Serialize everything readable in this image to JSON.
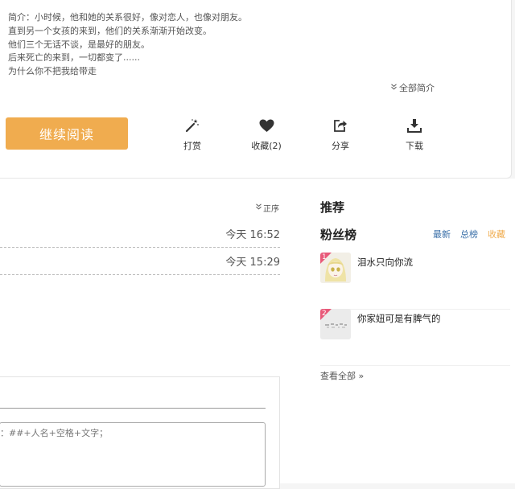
{
  "intro": {
    "lines": [
      "简介：小时候，他和她的关系很好，像对恋人，也像对朋友。",
      "直到另一个女孩的来到，他们的关系渐渐开始改变。",
      "他们三个无话不谈，是最好的朋友。",
      "后来死亡的来到，一切都变了......",
      "为什么你不把我给带走"
    ],
    "toggle_icon": "double-chevron-down-icon",
    "toggle_label": "全部简介"
  },
  "actions": {
    "read_label": "继续阅读",
    "reward_label": "打赏",
    "favorite_label": "收藏(2)",
    "share_label": "分享",
    "download_label": "下载"
  },
  "chapters": {
    "sort_label": "正序",
    "rows": [
      {
        "time": "今天 16:52"
      },
      {
        "time": "今天 15:29"
      }
    ]
  },
  "comment": {
    "placeholder": "：##+人名+空格+文字；"
  },
  "sidebar": {
    "recommend_title": "推荐",
    "fans_title": "粉丝榜",
    "tabs": [
      "最新",
      "总榜",
      "收藏"
    ],
    "active_tab": "收藏",
    "fans": [
      {
        "rank": "1",
        "name": "泪水只向你流"
      },
      {
        "rank": "2",
        "name": "你家妞可是有脾气的"
      }
    ],
    "view_all": "查看全部 »"
  },
  "colors": {
    "accent": "#f0ac4f",
    "link": "#3a6fa8",
    "rank_badge": "#e85a7a"
  }
}
